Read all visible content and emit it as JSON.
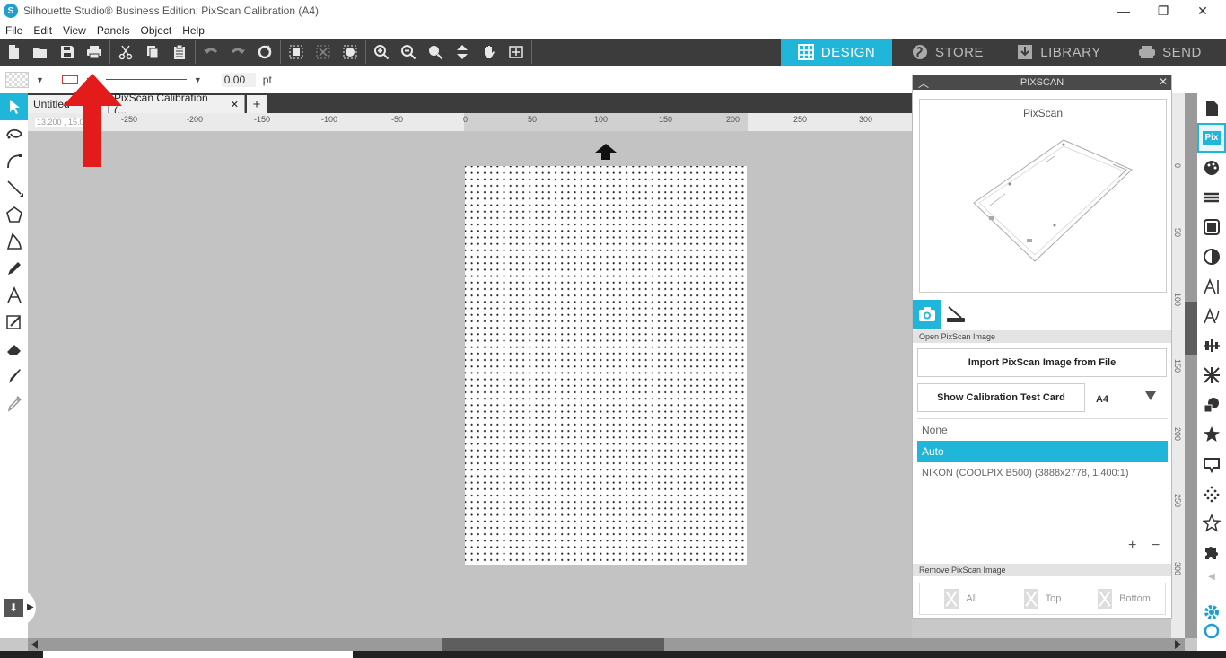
{
  "window": {
    "title": "Silhouette Studio® Business Edition: PixScan Calibration (A4)",
    "minimize": "—",
    "maximize": "❐",
    "close": "✕"
  },
  "menu": [
    "File",
    "Edit",
    "View",
    "Panels",
    "Object",
    "Help"
  ],
  "nav": {
    "design": "DESIGN",
    "store": "STORE",
    "library": "LIBRARY",
    "send": "SEND",
    "active_color": "#1fb6d9"
  },
  "propbar": {
    "line_width": "0.00",
    "unit": "pt"
  },
  "doc_tabs": [
    {
      "label": "Untitled"
    },
    {
      "label": "PixScan Calibration (..."
    }
  ],
  "add_tab": "+",
  "ruler": {
    "coord": "13.200 , 15.000",
    "ticks": [
      "-250",
      "-200",
      "-150",
      "-100",
      "-50",
      "0",
      "50",
      "100",
      "150",
      "200",
      "250",
      "300"
    ],
    "vticks": [
      "0",
      "50",
      "100",
      "150",
      "200",
      "250",
      "300"
    ]
  },
  "pixscan": {
    "panel_title": "PIXSCAN",
    "preview_title": "PixScan",
    "section_open": "Open PixScan Image",
    "import_btn": "Import PixScan Image from File",
    "calib_btn": "Show Calibration Test Card",
    "paper_size": "A4",
    "cameras": [
      {
        "label": "None",
        "selected": false
      },
      {
        "label": "Auto",
        "selected": true
      },
      {
        "label": "NIKON (COOLPIX B500) (3888x2778, 1.400:1)",
        "selected": false
      }
    ],
    "add": "+",
    "remove": "−",
    "section_remove": "Remove PixScan Image",
    "remove_all": "All",
    "remove_top": "Top",
    "remove_bottom": "Bottom"
  },
  "annotation": {
    "arrow_color": "#e31b1b"
  }
}
